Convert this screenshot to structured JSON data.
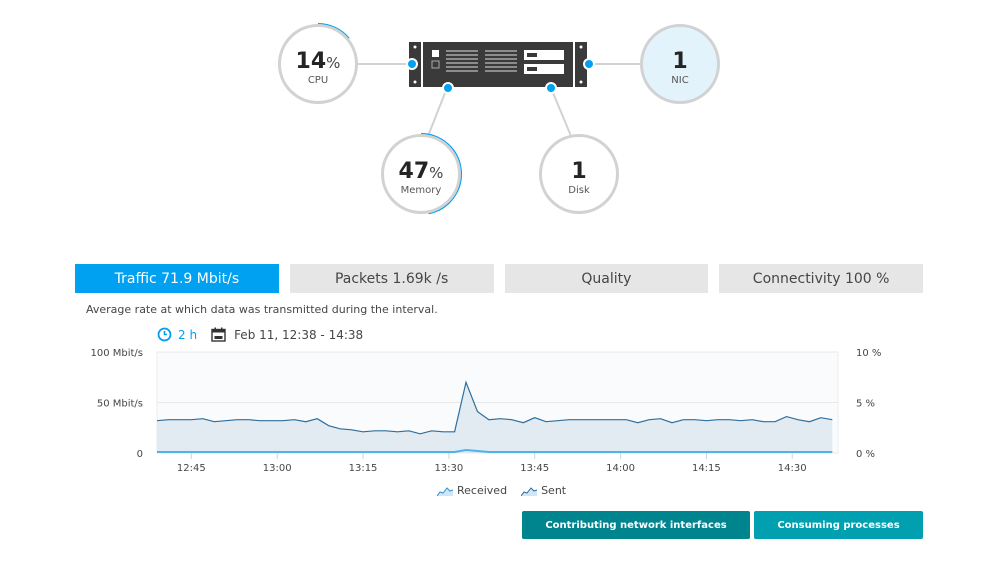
{
  "topology": {
    "cpu": {
      "value": "14",
      "unit": "%",
      "label": "CPU",
      "usage_fraction": 0.14
    },
    "memory": {
      "value": "47",
      "unit": "%",
      "label": "Memory",
      "usage_fraction": 0.47
    },
    "disk": {
      "value": "1",
      "label": "Disk"
    },
    "nic": {
      "value": "1",
      "label": "NIC"
    },
    "host_icon": "server-rack-icon"
  },
  "colors": {
    "accent": "#00a1f0",
    "primary_button": "#00848e",
    "secondary_button": "#00a0b0",
    "received_line": "#2e6f9e",
    "sent_line": "#4fb3e8"
  },
  "tabs": [
    {
      "label": "Traffic 71.9 Mbit/s",
      "active": true
    },
    {
      "label": "Packets 1.69k /s",
      "active": false
    },
    {
      "label": "Quality",
      "active": false
    },
    {
      "label": "Connectivity 100 %",
      "active": false
    }
  ],
  "description": "Average rate at which data was transmitted during the interval.",
  "timeframe": {
    "duration": "2 h",
    "range": "Feb 11, 12:38 - 14:38",
    "clock_icon": "clock-icon",
    "calendar_icon": "calendar-icon"
  },
  "legend": [
    {
      "label": "Received",
      "icon": "area-chart-icon"
    },
    {
      "label": "Sent",
      "icon": "area-chart-icon"
    }
  ],
  "buttons": {
    "primary": "Contributing network interfaces",
    "secondary": "Consuming processes"
  },
  "chart_data": {
    "type": "area",
    "title": "",
    "xlabel": "",
    "ylabel": "Mbit/s",
    "x_start_minute": 759,
    "x_end_minute": 878,
    "x_ticks": [
      "12:45",
      "13:00",
      "13:15",
      "13:30",
      "13:45",
      "14:00",
      "14:15",
      "14:30"
    ],
    "x_tick_minutes": [
      765,
      780,
      795,
      810,
      825,
      840,
      855,
      870
    ],
    "y_ticks_left": [
      "0",
      "50 Mbit/s",
      "100 Mbit/s"
    ],
    "y_tick_values_left": [
      0,
      50,
      100
    ],
    "y_ticks_right": [
      "0 %",
      "5 %",
      "10 %"
    ],
    "ylim": [
      0,
      100
    ],
    "grid": true,
    "legend_position": "bottom-center",
    "x_minutes": [
      759,
      761,
      763,
      765,
      767,
      769,
      771,
      773,
      775,
      777,
      779,
      781,
      783,
      785,
      787,
      789,
      791,
      793,
      795,
      797,
      799,
      801,
      803,
      805,
      807,
      809,
      811,
      813,
      815,
      817,
      819,
      821,
      823,
      825,
      827,
      829,
      831,
      833,
      835,
      837,
      839,
      841,
      843,
      845,
      847,
      849,
      851,
      853,
      855,
      857,
      859,
      861,
      863,
      865,
      867,
      869,
      871,
      873,
      875,
      877
    ],
    "series": [
      {
        "name": "Received",
        "values": [
          32,
          33,
          33,
          33,
          34,
          31,
          32,
          33,
          33,
          32,
          32,
          32,
          33,
          31,
          34,
          27,
          24,
          23,
          21,
          22,
          22,
          21,
          22,
          19,
          22,
          21,
          21,
          70,
          41,
          33,
          34,
          33,
          30,
          35,
          31,
          32,
          33,
          33,
          33,
          33,
          33,
          33,
          30,
          33,
          34,
          30,
          33,
          33,
          32,
          33,
          33,
          32,
          33,
          31,
          31,
          36,
          33,
          31,
          35,
          33
        ]
      },
      {
        "name": "Sent",
        "values": [
          1,
          1,
          1,
          1,
          1,
          1,
          1,
          1,
          1,
          1,
          1,
          1,
          1,
          1,
          1,
          1,
          1,
          1,
          1,
          1,
          1,
          1,
          1,
          1,
          1,
          1,
          1,
          3,
          2,
          1,
          1,
          1,
          1,
          1,
          1,
          1,
          1,
          1,
          1,
          1,
          1,
          1,
          1,
          1,
          1,
          1,
          1,
          1,
          1,
          1,
          1,
          1,
          1,
          1,
          1,
          1,
          1,
          1,
          1,
          1
        ]
      }
    ]
  }
}
